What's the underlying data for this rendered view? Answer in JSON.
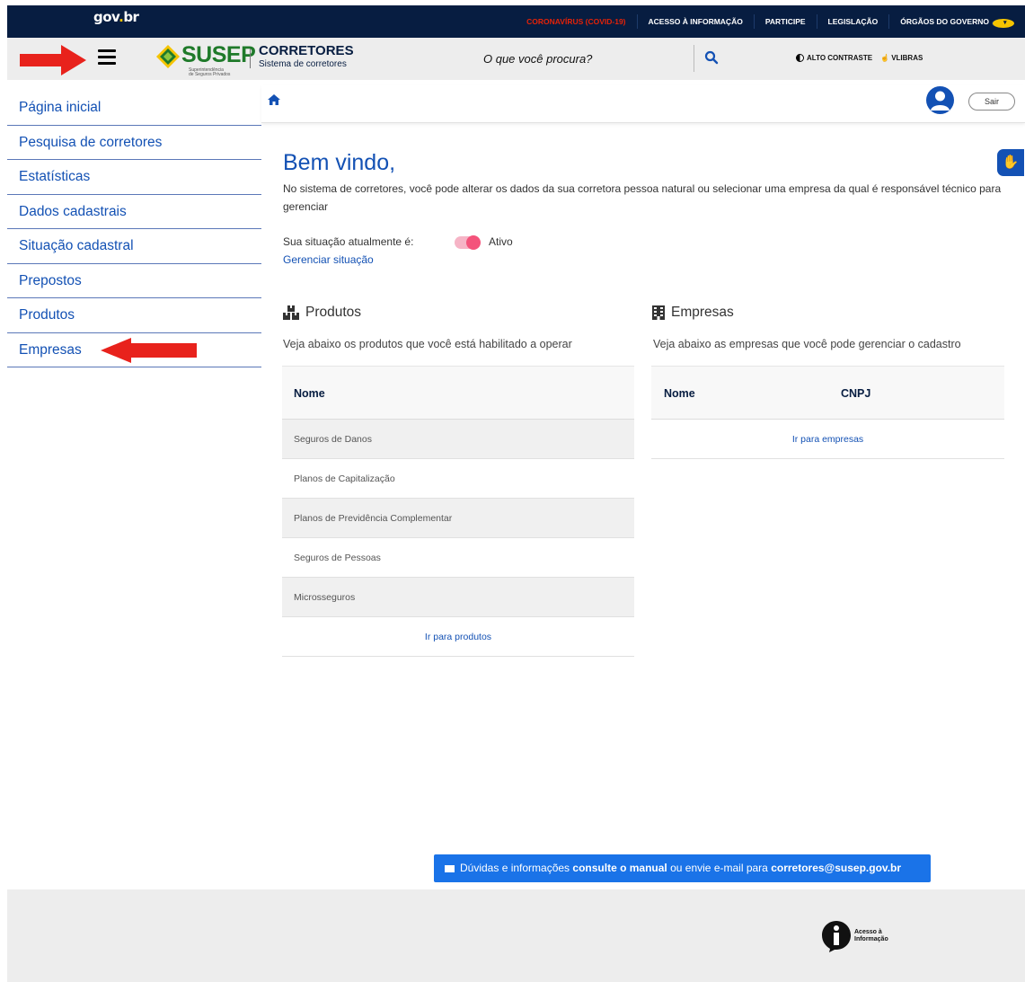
{
  "govbar": {
    "logo_text": "gov",
    "logo_suffix": "br",
    "links": [
      "CORONAVÍRUS (COVID-19)",
      "ACESSO À INFORMAÇÃO",
      "PARTICIPE",
      "LEGISLAÇÃO",
      "ÓRGÃOS DO GOVERNO"
    ]
  },
  "header": {
    "brand": "SUSEP",
    "brand_sub_1": "Superintendência",
    "brand_sub_2": "de Seguros Privados",
    "system_title": "CORRETORES",
    "system_subtitle": "Sistema de corretores",
    "search_placeholder": "O que você procura?",
    "alto_contraste": "ALTO CONTRASTE",
    "vlibras": "VLIBRAS"
  },
  "sidebar": {
    "items": [
      {
        "label": "Página inicial"
      },
      {
        "label": "Pesquisa de corretores"
      },
      {
        "label": "Estatísticas"
      },
      {
        "label": "Dados cadastrais"
      },
      {
        "label": "Situação cadastral"
      },
      {
        "label": "Prepostos"
      },
      {
        "label": "Produtos"
      },
      {
        "label": "Empresas"
      }
    ]
  },
  "topbar": {
    "logout_label": "Sair"
  },
  "main": {
    "welcome": "Bem vindo,",
    "intro": "No sistema de corretores, você pode alterar os dados da sua corretora pessoa natural ou selecionar uma empresa da qual é responsável técnico para gerenciar",
    "status_label": "Sua situação atualmente é:",
    "status_value": "Ativo",
    "status_active": true,
    "manage_status": "Gerenciar situação"
  },
  "produtos": {
    "title": "Produtos",
    "description": "Veja abaixo os produtos que você está habilitado a operar",
    "column": "Nome",
    "rows": [
      "Seguros de Danos",
      "Planos de Capitalização",
      "Planos de Previdência Complementar",
      "Seguros de Pessoas",
      "Microsseguros"
    ],
    "link": "Ir para produtos"
  },
  "empresas": {
    "title": "Empresas",
    "description": "Veja abaixo as empresas que você pode gerenciar o cadastro",
    "columns": [
      "Nome",
      "CNPJ"
    ],
    "link": "Ir para empresas"
  },
  "footer": {
    "help_prefix": "Dúvidas e informações",
    "help_manual": "consulte o manual",
    "help_middle": "ou envie e-mail para",
    "help_email": "corretores@susep.gov.br",
    "acesso_line1": "Acesso à",
    "acesso_line2": "Informação"
  },
  "colors": {
    "gov_blue": "#071d41",
    "primary": "#1351b4",
    "covid_red": "#e52207",
    "susep_green": "#1f7a2a",
    "toggle_pink": "#f4537b",
    "annotation_arrow": "#e8221c"
  }
}
